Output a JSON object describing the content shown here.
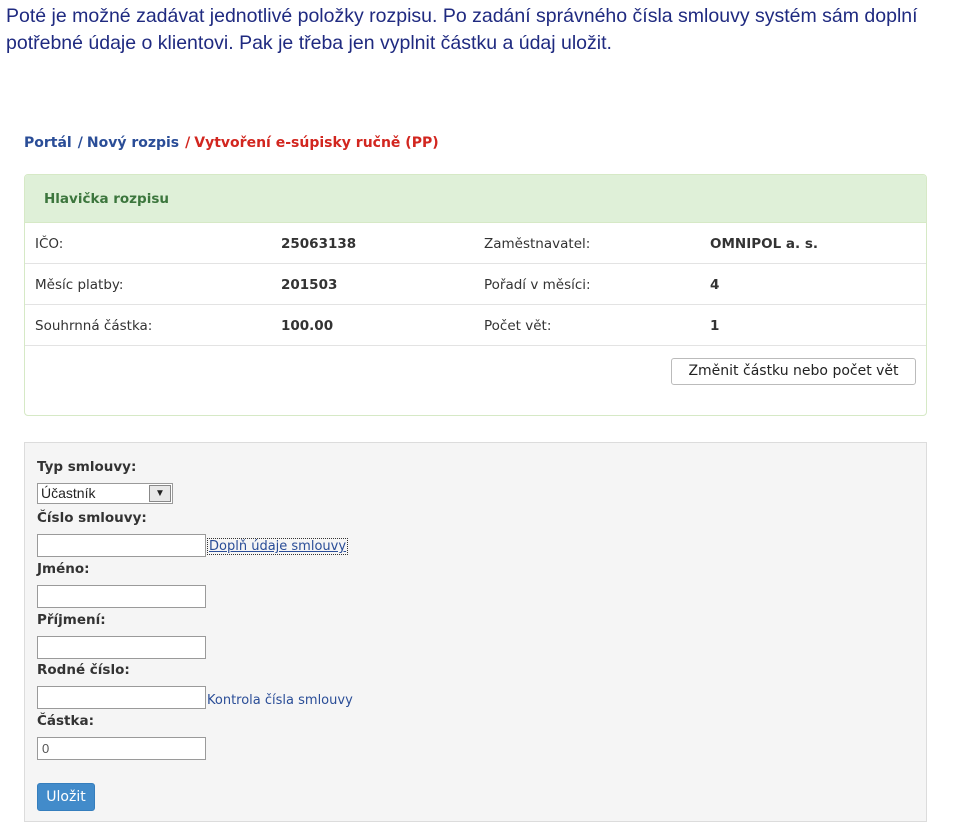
{
  "intro": {
    "text": "Poté je možné zadávat jednotlivé položky rozpisu. Po zadání správného čísla smlouvy systém sám doplní potřebné údaje o klientovi. Pak je třeba jen vyplnit částku a údaj uložit."
  },
  "breadcrumb": {
    "items": [
      "Portál",
      "Nový rozpis",
      "Vytvoření e-súpisky ručně (PP)"
    ],
    "separator": "/"
  },
  "header_panel": {
    "title": "Hlavička rozpisu",
    "rows": [
      {
        "label1": "IČO:",
        "value1": "25063138",
        "label2": "Zaměstnavatel:",
        "value2": "OMNIPOL a. s."
      },
      {
        "label1": "Měsíc platby:",
        "value1": "201503",
        "label2": "Pořadí v měsíci:",
        "value2": "4"
      },
      {
        "label1": "Souhrnná částka:",
        "value1": "100.00",
        "label2": "Počet vět:",
        "value2": "1"
      }
    ],
    "change_button": "Změnit částku nebo počet vět"
  },
  "form": {
    "contract_type_label": "Typ smlouvy:",
    "contract_type_value": "Účastník",
    "contract_number_label": "Číslo smlouvy:",
    "contract_number_value": "",
    "fill_link": "Doplň údaje smlouvy",
    "first_name_label": "Jméno:",
    "first_name_value": "",
    "last_name_label": "Příjmení:",
    "last_name_value": "",
    "birth_number_label": "Rodné číslo:",
    "birth_number_value": "",
    "check_link": "Kontrola čísla smlouvy",
    "amount_label": "Částka:",
    "amount_value": "0",
    "save_button": "Uložit"
  },
  "colors": {
    "intro_text": "#1f2a80",
    "breadcrumb_link": "#2a4d97",
    "breadcrumb_current": "#d2261f",
    "panel_heading_bg": "#dff0d8",
    "panel_heading_text": "#3c763d",
    "primary_button": "#428bca"
  },
  "icons": {
    "select_arrow": "chevron-down-icon"
  }
}
